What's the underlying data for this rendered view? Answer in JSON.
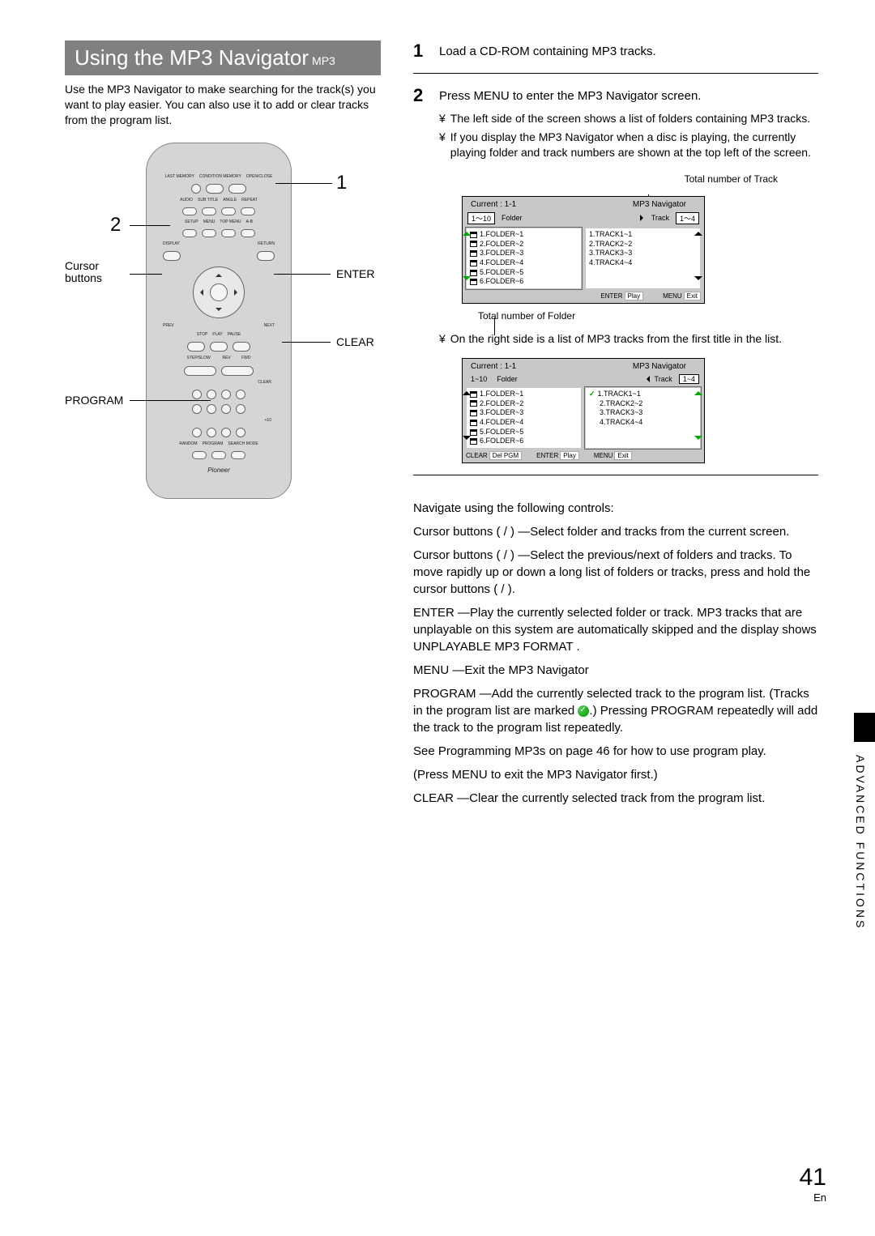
{
  "heading": {
    "title": "Using the MP3 Navigator",
    "sub": "MP3"
  },
  "intro": "Use the MP3 Navigator to make searching for the track(s) you want to play easier. You can also use it to add or clear tracks from the program list.",
  "remote_callouts": {
    "num1": "1",
    "num2": "2",
    "cursor": "Cursor buttons",
    "enter": "ENTER",
    "clear": "CLEAR",
    "program": "PROGRAM"
  },
  "remote_labels": {
    "top": "OPEN/CLOSE",
    "last": "LAST MEMORY",
    "cond": "CONDITION MEMORY",
    "audio": "AUDIO",
    "subtitle": "SUB TITLE",
    "angle": "ANGLE",
    "repeat": "REPEAT",
    "setup": "SETUP",
    "menu": "MENU",
    "topmenu": "TOP MENU",
    "ab": "A-B",
    "display": "DISPLAY",
    "return": "RETURN",
    "prev": "PREV",
    "next": "NEXT",
    "stop": "STOP",
    "play": "PLAY",
    "pause": "PAUSE",
    "stepslow": "STEP/SLOW",
    "rev": "REV",
    "fwd": "FWD",
    "clear": "CLEAR",
    "plus10": "+10",
    "random": "RANDOM",
    "program": "PROGRAM",
    "search": "SEARCH MODE",
    "pioneer": "Pioneer"
  },
  "steps": {
    "s1": {
      "n": "1",
      "text": "Load a CD-ROM containing MP3 tracks."
    },
    "s2": {
      "n": "2",
      "text": "Press MENU to enter the MP3 Navigator screen.",
      "b1": "The left side of the screen shows a list of folders containing MP3 tracks.",
      "b2": "If you display the MP3 Navigator when a disc is playing, the currently playing folder and track numbers are shown at the top left of the screen.",
      "b3": "On the right side is a list of MP3 tracks from the first title in the list."
    }
  },
  "nav_captions": {
    "top_right": "Total number of Track",
    "below": "Total number of Folder"
  },
  "chart_data": [
    {
      "type": "table",
      "title": "MP3 Navigator (folder focus)",
      "current": "Current :    1-1",
      "corner": "MP3 Navigator",
      "folder_range": "1～10",
      "track_range": "1～4",
      "folder_header": "Folder",
      "track_header": "Track",
      "folders": [
        "1.FOLDER~1",
        "2.FOLDER~2",
        "3.FOLDER~3",
        "4.FOLDER~4",
        "5.FOLDER~5",
        "6.FOLDER~6"
      ],
      "tracks": [
        "1.TRACK1~1",
        "2.TRACK2~2",
        "3.TRACK3~3",
        "4.TRACK4~4"
      ],
      "footer": {
        "enter": "ENTER",
        "play": "Play",
        "menu": "MENU",
        "exit": "Exit"
      },
      "active_side": "folder"
    },
    {
      "type": "table",
      "title": "MP3 Navigator (track focus)",
      "current": "Current :    1-1",
      "corner": "MP3 Navigator",
      "folder_range": "1~10",
      "track_range": "1~4",
      "folder_header": "Folder",
      "track_header": "Track",
      "folders": [
        "1.FOLDER~1",
        "2.FOLDER~2",
        "3.FOLDER~3",
        "4.FOLDER~4",
        "5.FOLDER~5",
        "6.FOLDER~6"
      ],
      "tracks": [
        "1.TRACK1~1",
        "2.TRACK2~2",
        "3.TRACK3~3",
        "4.TRACK4~4"
      ],
      "footer": {
        "clear": "CLEAR",
        "del": "Del PGM",
        "enter": "ENTER",
        "play": "Play",
        "menu": "MENU",
        "exit": "Exit"
      },
      "active_side": "track",
      "checked_track_index": 0
    }
  ],
  "controls": {
    "title": "Navigate using the following controls:",
    "cursor1": "Cursor buttons   (   /   )  —Select folder and tracks from the current screen.",
    "cursor2": "Cursor buttons   (   /   ) —Select the previous/next of folders and tracks. To move rapidly up or down a long list of folders or tracks, press and hold the  cursor buttons  (   /   ).",
    "enter": "ENTER —Play the currently selected folder or track. MP3 tracks that are unplayable on this system are automatically skipped and the display shows   UNPLAYABLE MP3 FORMAT   .",
    "menu": "MENU  —Exit the MP3 Navigator",
    "program1": "PROGRAM —Add the currently selected track to the program list. (Tracks in the program list are  marked",
    "program2": ".) Pressing PROGRAM repeatedly will add the track to the program list repeatedly.",
    "see1": "See  Programming MP3s     on page",
    "see_page": "46",
    "see2": " for how to use program play.",
    "pressmenu": "(Press MENU  to exit the MP3 Navigator first.)",
    "clear": "CLEAR —Clear the currently selected track from the program list."
  },
  "side_tab": "ADVANCED  FUNCTIONS",
  "page_number": "41",
  "page_lang": "En"
}
